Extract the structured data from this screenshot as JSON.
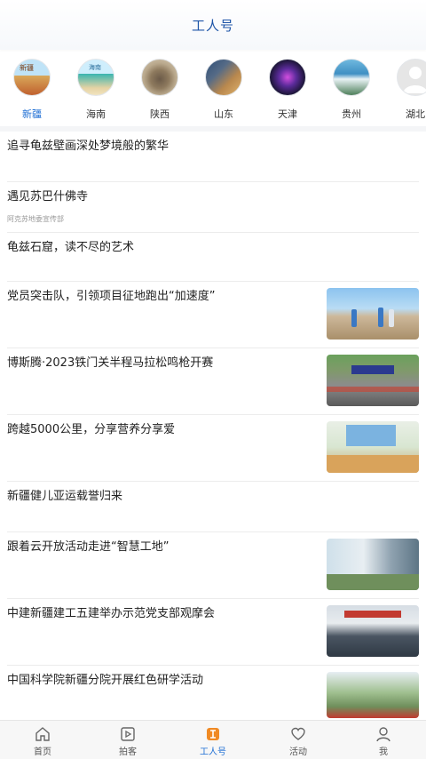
{
  "header": {
    "title": "工人号"
  },
  "regions": [
    {
      "label": "新疆",
      "active": true,
      "badge": "新疆"
    },
    {
      "label": "海南",
      "active": false,
      "badge": "海南"
    },
    {
      "label": "陕西",
      "active": false,
      "badge": ""
    },
    {
      "label": "山东",
      "active": false,
      "badge": ""
    },
    {
      "label": "天津",
      "active": false,
      "badge": ""
    },
    {
      "label": "贵州",
      "active": false,
      "badge": ""
    },
    {
      "label": "湖北",
      "active": false,
      "badge": ""
    }
  ],
  "feed": [
    {
      "title": "追寻龟兹壁画深处梦境般的繁华",
      "source": "",
      "has_image": false
    },
    {
      "title": "遇见苏巴什佛寺",
      "source": "阿克苏地委宣传部",
      "has_image": false
    },
    {
      "title": "龟兹石窟，读不尽的艺术",
      "source": "",
      "has_image": false
    },
    {
      "title": "党员突击队，引领项目征地跑出“加速度”",
      "source": "",
      "has_image": true
    },
    {
      "title": "博斯腾·2023铁门关半程马拉松鸣枪开赛",
      "source": "",
      "has_image": true
    },
    {
      "title": "跨越5000公里，分享营养分享爱",
      "source": "",
      "has_image": true
    },
    {
      "title": "新疆健儿亚运载誉归来",
      "source": "",
      "has_image": false
    },
    {
      "title": "跟着云开放活动走进“智慧工地”",
      "source": "",
      "has_image": true
    },
    {
      "title": "中建新疆建工五建举办示范党支部观摩会",
      "source": "",
      "has_image": true
    },
    {
      "title": "中国科学院新疆分院开展红色研学活动",
      "source": "",
      "has_image": true
    }
  ],
  "tabbar": [
    {
      "label": "首页",
      "icon": "home-icon",
      "active": false
    },
    {
      "label": "拍客",
      "icon": "play-icon",
      "active": false
    },
    {
      "label": "工人号",
      "icon": "worker-icon",
      "active": true
    },
    {
      "label": "活动",
      "icon": "heart-icon",
      "active": false
    },
    {
      "label": "我",
      "icon": "user-icon",
      "active": false
    }
  ],
  "colors": {
    "accent": "#1f6fd4",
    "title_blue": "#1f56a8"
  }
}
